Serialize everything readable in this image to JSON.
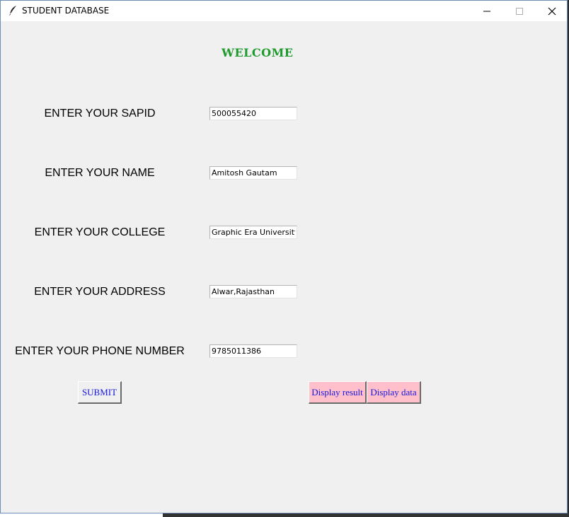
{
  "window": {
    "title": "STUDENT DATABASE"
  },
  "heading": "WELCOME",
  "fields": [
    {
      "label": "ENTER YOUR SAPID",
      "value": "500055420"
    },
    {
      "label": "ENTER YOUR NAME",
      "value": "Amitosh Gautam"
    },
    {
      "label": "ENTER YOUR COLLEGE",
      "value": "Graphic Era University"
    },
    {
      "label": "ENTER YOUR ADDRESS",
      "value": "Alwar,Rajasthan"
    },
    {
      "label": "ENTER YOUR PHONE NUMBER",
      "value": "9785011386"
    }
  ],
  "buttons": {
    "submit": "SUBMIT",
    "display_result": "Display result",
    "display_data": "Display data"
  },
  "colors": {
    "heading": "#1f9a2e",
    "button_text": "#1515e0",
    "pink_button_bg": "#ffc0cb"
  }
}
